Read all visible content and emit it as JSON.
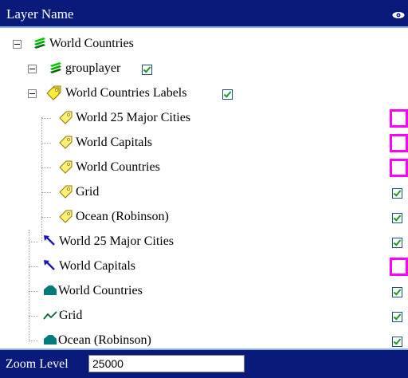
{
  "header": {
    "title": "Layer Name",
    "visibility_icon": "eye-icon"
  },
  "tree": {
    "root": {
      "label": "World Countries",
      "icon": "stacked-layers-icon"
    },
    "grouplayer": {
      "label": "grouplayer",
      "icon": "stacked-layers-icon",
      "checked": true
    },
    "labels_group": {
      "label": "World Countries Labels",
      "icon": "label-tag-icon",
      "checked": true
    },
    "label_layers": [
      {
        "label": "World 25 Major Cities",
        "icon": "label-tag-icon",
        "checked": false,
        "highlighted": true
      },
      {
        "label": "World Capitals",
        "icon": "label-tag-icon",
        "checked": false,
        "highlighted": true
      },
      {
        "label": "World Countries",
        "icon": "label-tag-icon",
        "checked": false,
        "highlighted": true
      },
      {
        "label": "Grid",
        "icon": "label-tag-icon",
        "checked": true,
        "highlighted": false
      },
      {
        "label": "Ocean (Robinson)",
        "icon": "label-tag-icon",
        "checked": true,
        "highlighted": false
      }
    ],
    "layers": [
      {
        "label": "World 25 Major Cities",
        "icon": "point-pin-icon",
        "checked": true,
        "highlighted": false
      },
      {
        "label": "World Capitals",
        "icon": "point-pin-icon",
        "checked": false,
        "highlighted": true
      },
      {
        "label": "World Countries",
        "icon": "polygon-icon",
        "checked": true,
        "highlighted": false
      },
      {
        "label": "Grid",
        "icon": "polyline-icon",
        "checked": true,
        "highlighted": false
      },
      {
        "label": "Ocean (Robinson)",
        "icon": "polygon-icon",
        "checked": true,
        "highlighted": false
      }
    ]
  },
  "footer": {
    "zoom_label": "Zoom Level",
    "zoom_value": "25000"
  },
  "colors": {
    "header_bg": "#0a1a7a",
    "highlight": "#ff00ff",
    "check": "#1a9a1a"
  }
}
